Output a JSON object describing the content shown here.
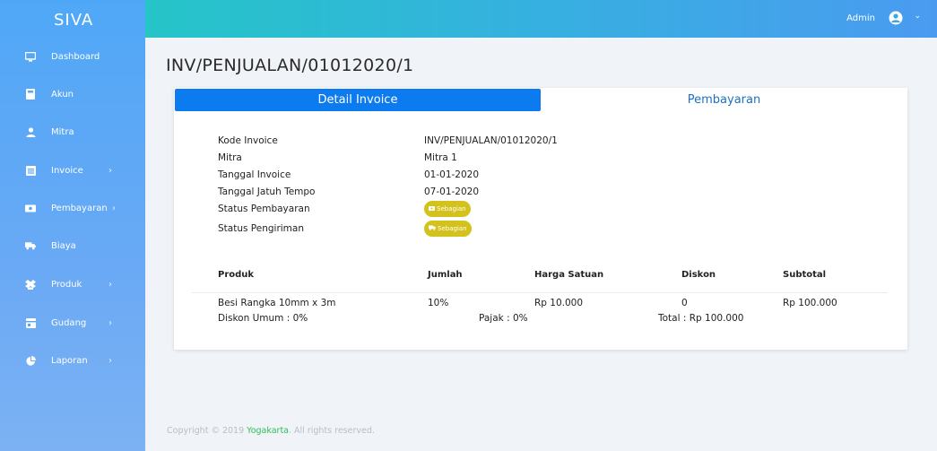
{
  "app": {
    "brand": "SIVA"
  },
  "sidebar": {
    "items": [
      {
        "label": "Dashboard",
        "icon": "monitor-icon",
        "has_children": false
      },
      {
        "label": "Akun",
        "icon": "calculator-icon",
        "has_children": false
      },
      {
        "label": "Mitra",
        "icon": "user-icon",
        "has_children": false
      },
      {
        "label": "Invoice",
        "icon": "list-icon",
        "has_children": true
      },
      {
        "label": "Pembayaran",
        "icon": "money-icon",
        "has_children": true
      },
      {
        "label": "Biaya",
        "icon": "truck-icon",
        "has_children": false
      },
      {
        "label": "Produk",
        "icon": "box-icon",
        "has_children": true
      },
      {
        "label": "Gudang",
        "icon": "warehouse-icon",
        "has_children": true
      },
      {
        "label": "Laporan",
        "icon": "chart-pie-icon",
        "has_children": true
      }
    ],
    "chevron": "›"
  },
  "topbar": {
    "user_label": "Admin",
    "caret": "⌄"
  },
  "page": {
    "title": "INV/PENJUALAN/01012020/1"
  },
  "tabs": [
    {
      "label": "Detail Invoice",
      "active": true
    },
    {
      "label": "Pembayaran",
      "active": false
    }
  ],
  "details": {
    "kode_invoice_label": "Kode Invoice",
    "kode_invoice_value": "INV/PENJUALAN/01012020/1",
    "mitra_label": "Mitra",
    "mitra_value": "Mitra 1",
    "tanggal_invoice_label": "Tanggal Invoice",
    "tanggal_invoice_value": "01-01-2020",
    "jatuh_tempo_label": "Tanggal Jatuh Tempo",
    "jatuh_tempo_value": "07-01-2020",
    "status_pembayaran_label": "Status Pembayaran",
    "status_pembayaran_value": "Sebagian",
    "status_pengiriman_label": "Status Pengiriman",
    "status_pengiriman_value": "Sebagian"
  },
  "table": {
    "columns": [
      "Produk",
      "Jumlah",
      "Harga Satuan",
      "Diskon",
      "Subtotal"
    ],
    "rows": [
      [
        "Besi Rangka 10mm x 3m",
        "10%",
        "Rp 10.000",
        "0",
        "Rp 100.000"
      ]
    ],
    "footer": {
      "diskon_umum": "Diskon Umum : 0%",
      "pajak": "Pajak : 0%",
      "total": "Total : Rp 100.000"
    }
  },
  "footer": {
    "prefix": "Copyright © 2019",
    "brand": "Yogakarta",
    "suffix": ". All rights reserved."
  },
  "colors": {
    "sidebar_top": "#4fa8f7",
    "topbar_left": "#25c5c8",
    "topbar_right": "#4a9bf0",
    "tab_active": "#0d7bf0",
    "badge": "#d4c21c",
    "footer_brand": "#2fbf55"
  }
}
